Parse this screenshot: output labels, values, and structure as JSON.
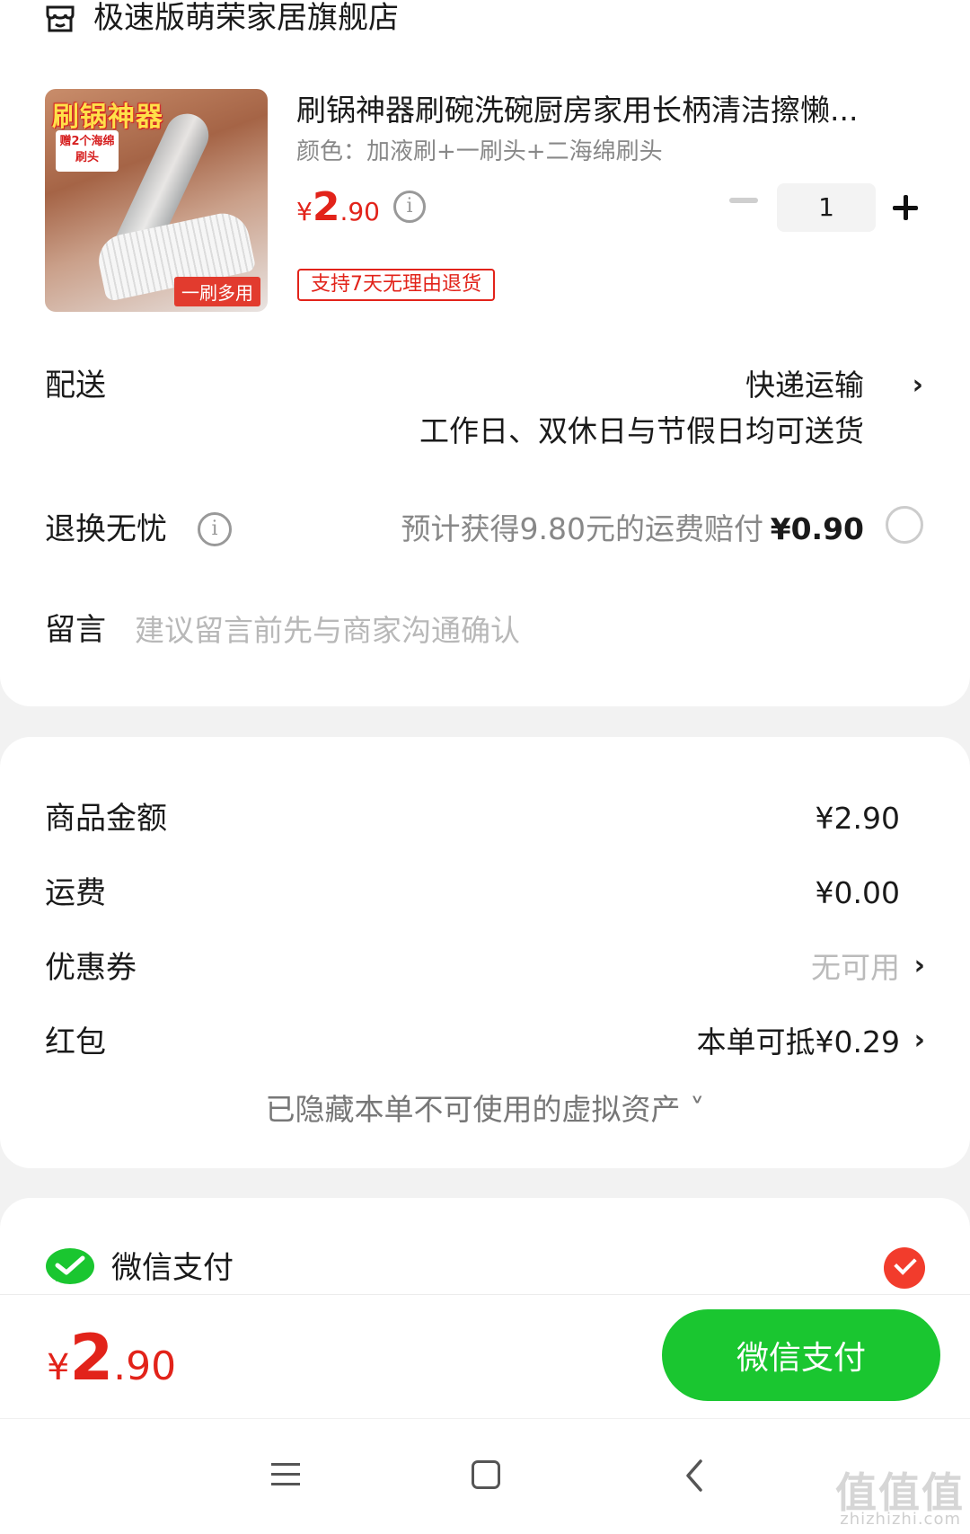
{
  "store": {
    "name": "极速版萌荣家居旗舰店",
    "icon": "store-icon"
  },
  "product": {
    "title": "刷锅神器刷碗洗碗厨房家用长柄清洁擦懒...",
    "variant": "颜色：加液刷+一刷头+二海绵刷头",
    "price_symbol": "¥",
    "price_int": "2",
    "price_dec": ".90",
    "quantity": "1",
    "return_badge": "支持7天无理由退货",
    "image_text": {
      "title": "刷锅神器",
      "gift": "赠2个海绵刷头",
      "tag": "一刷多用"
    }
  },
  "delivery": {
    "label": "配送",
    "method": "快递运输",
    "desc": "工作日、双休日与节假日均可送货"
  },
  "return_worry_free": {
    "label": "退换无忧",
    "desc": "预计获得9.80元的运费赔付",
    "price": "¥0.90",
    "selected": false
  },
  "message": {
    "label": "留言",
    "placeholder": "建议留言前先与商家沟通确认"
  },
  "summary": {
    "goods_label": "商品金额",
    "goods_value": "¥2.90",
    "shipping_label": "运费",
    "shipping_value": "¥0.00",
    "coupon_label": "优惠券",
    "coupon_value": "无可用",
    "redpacket_label": "红包",
    "redpacket_value": "本单可抵¥0.29",
    "hidden_assets": "已隐藏本单不可使用的虚拟资产 ˅"
  },
  "payment": {
    "method_label": "微信支付",
    "selected": true
  },
  "bottom": {
    "total_symbol": "¥",
    "total_int": "2",
    "total_dec": ".90",
    "pay_button": "微信支付"
  },
  "watermark": {
    "text": "值值值",
    "sub": "zhizhizhi.com"
  },
  "colors": {
    "accent_red": "#e2231a",
    "wechat_green": "#1ac630",
    "check_red": "#f23c2c"
  }
}
